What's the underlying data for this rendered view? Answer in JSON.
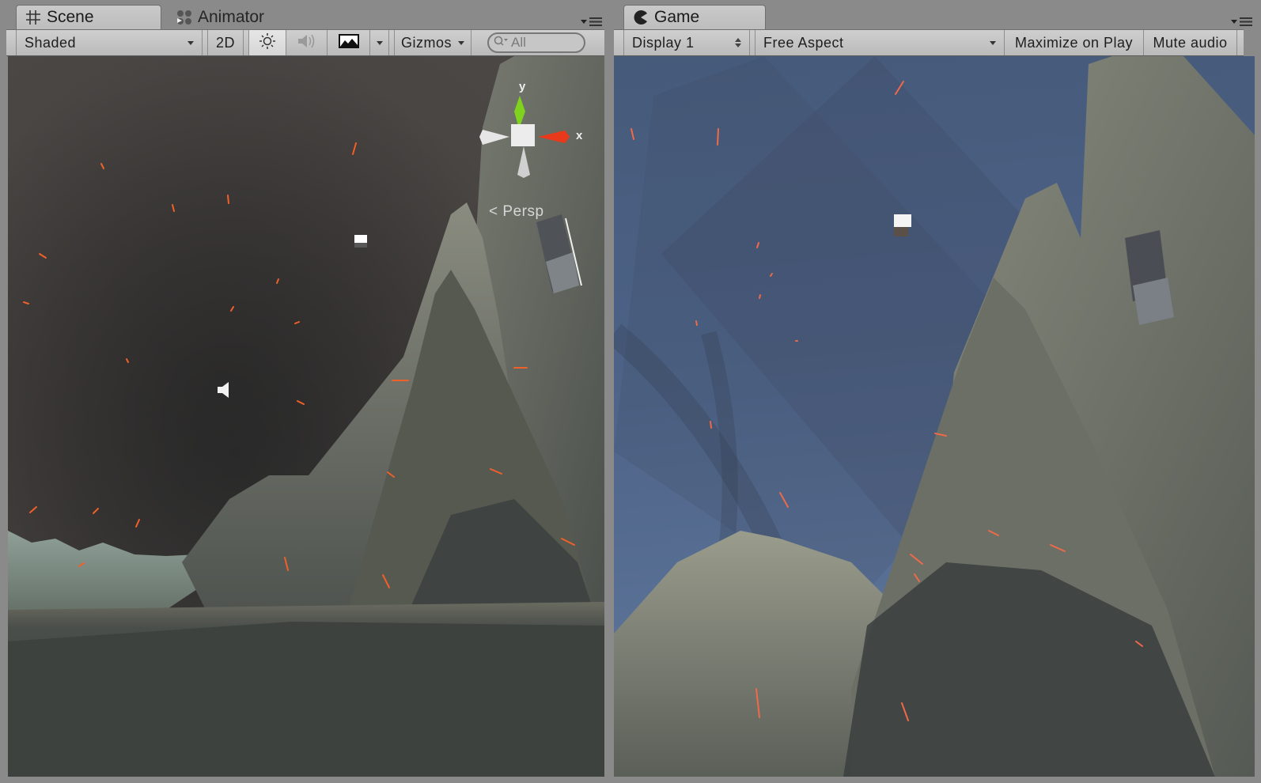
{
  "scene_panel": {
    "tabs": [
      {
        "label": "Scene",
        "icon": "grid-hash-icon",
        "active": true
      },
      {
        "label": "Animator",
        "icon": "animator-nodes-icon",
        "active": false
      }
    ],
    "toolbar": {
      "draw_mode": "Shaded",
      "mode_2d": "2D",
      "lighting_icon": "sun-icon",
      "lighting_on": true,
      "audio_icon": "speaker-icon",
      "audio_on": false,
      "effects_icon": "image-icon",
      "gizmos_label": "Gizmos",
      "search_placeholder": "All"
    },
    "view_gizmo": {
      "projection_label": "Persp",
      "axis_y_label": "y",
      "axis_x_label": "x",
      "colors": {
        "y": "#7fd21e",
        "x": "#e8391a",
        "neutral": "#e6e6e6"
      }
    }
  },
  "game_panel": {
    "tabs": [
      {
        "label": "Game",
        "icon": "pacman-icon",
        "active": true
      }
    ],
    "toolbar": {
      "display": "Display 1",
      "aspect": "Free Aspect",
      "maximize_on_play": "Maximize on Play",
      "mute_audio": "Mute audio"
    }
  },
  "colors": {
    "editor_bg": "#8a8a8a",
    "toolbar_bg": "#c4c4c4",
    "scene_sky": "#4a4644",
    "game_sky": "#4c6286",
    "ember": "#f0602a"
  }
}
